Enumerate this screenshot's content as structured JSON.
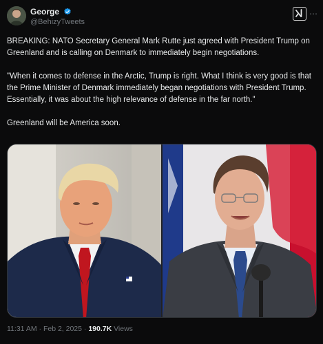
{
  "author": {
    "display_name": "George",
    "handle": "@BehizyTweets",
    "verified": true,
    "avatar_icon": "profile-avatar"
  },
  "icons": {
    "grok": "grok-icon",
    "more": "more-options-icon",
    "verified": "verified-badge-icon"
  },
  "tweet": {
    "paragraph_1": "BREAKING: NATO Secretary General Mark Rutte just agreed with President Trump on Greenland and is calling on Denmark to immediately begin negotiations.",
    "paragraph_2": "\"When it comes to defense in the Arctic, Trump is right. What I think is very good is that the Prime Minister of Denmark immediately began negotiations with President Trump. Essentially, it was about the high relevance of defense in the far north.\"",
    "paragraph_3": "Greenland will be America soon."
  },
  "media": {
    "left_photo": "man-in-navy-suit-red-tie",
    "right_photo": "man-in-grey-suit-blue-tie-microphone"
  },
  "meta": {
    "time": "11:31 AM",
    "separator": "·",
    "date": "Feb 2, 2025",
    "views_count": "190.7K",
    "views_label": "Views"
  },
  "colors": {
    "background": "#0b0b0c",
    "text": "#e7e9ea",
    "muted": "#71767b",
    "verified": "#1d9bf0"
  }
}
